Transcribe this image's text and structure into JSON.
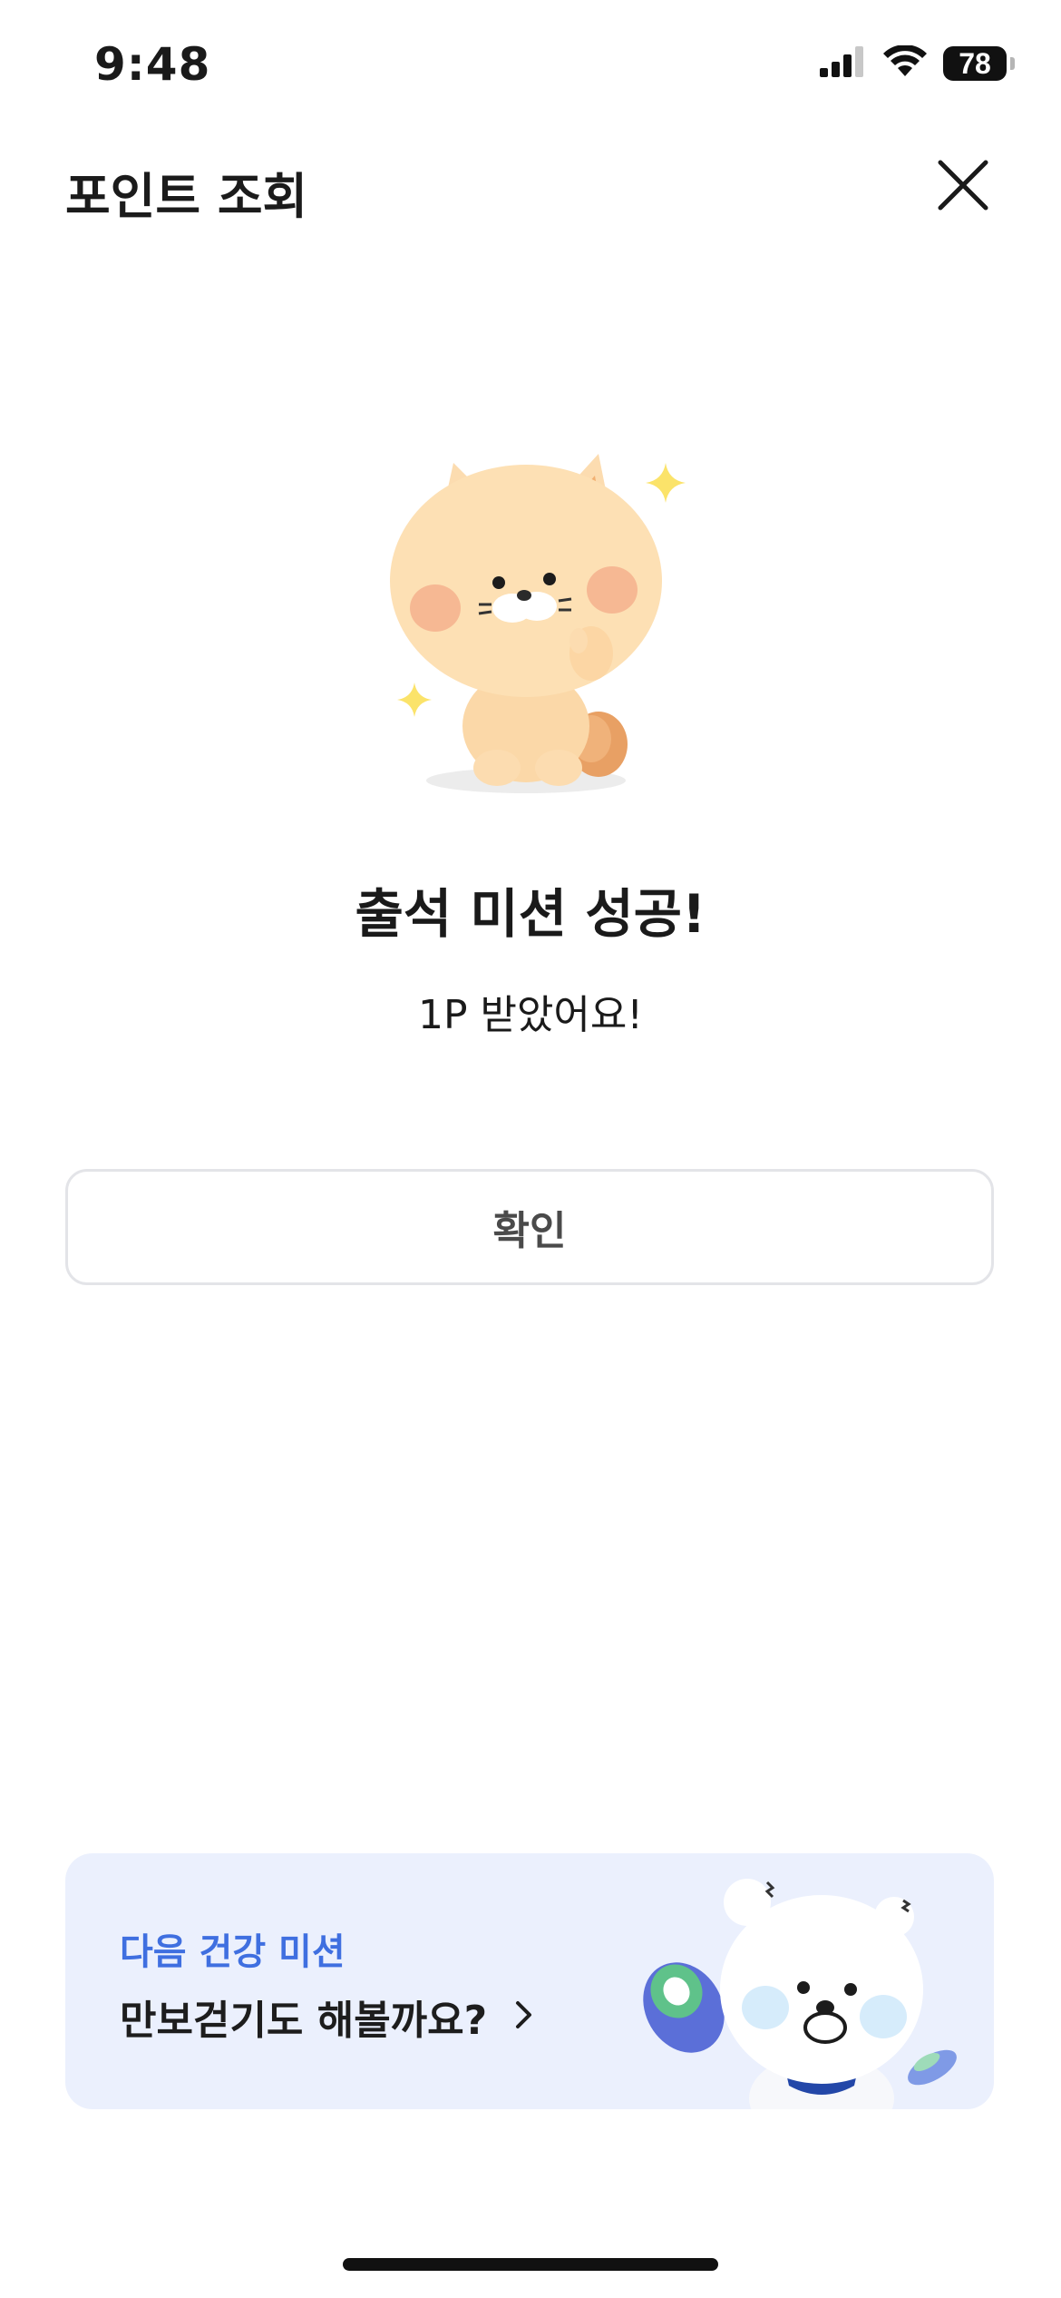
{
  "status_bar": {
    "time": "9:48",
    "battery": "78",
    "icons": [
      "signal-icon",
      "wifi-icon",
      "battery-icon"
    ]
  },
  "header": {
    "title": "포인트 조회",
    "close_icon": "close-icon"
  },
  "result": {
    "illustration": "cat-character-illustration",
    "headline": "출석 미션 성공!",
    "subline": "1P 받았어요!"
  },
  "confirm_button": {
    "label": "확인"
  },
  "next_mission": {
    "label": "다음 건강 미션",
    "title": "만보걷기도 해볼까요?",
    "arrow_icon": "chevron-right-icon",
    "illustration": "bear-with-sneakers-illustration"
  },
  "colors": {
    "accent_blue": "#3f6fe0",
    "banner_bg": "#ebf0fd",
    "button_border": "#e3e4e8"
  }
}
